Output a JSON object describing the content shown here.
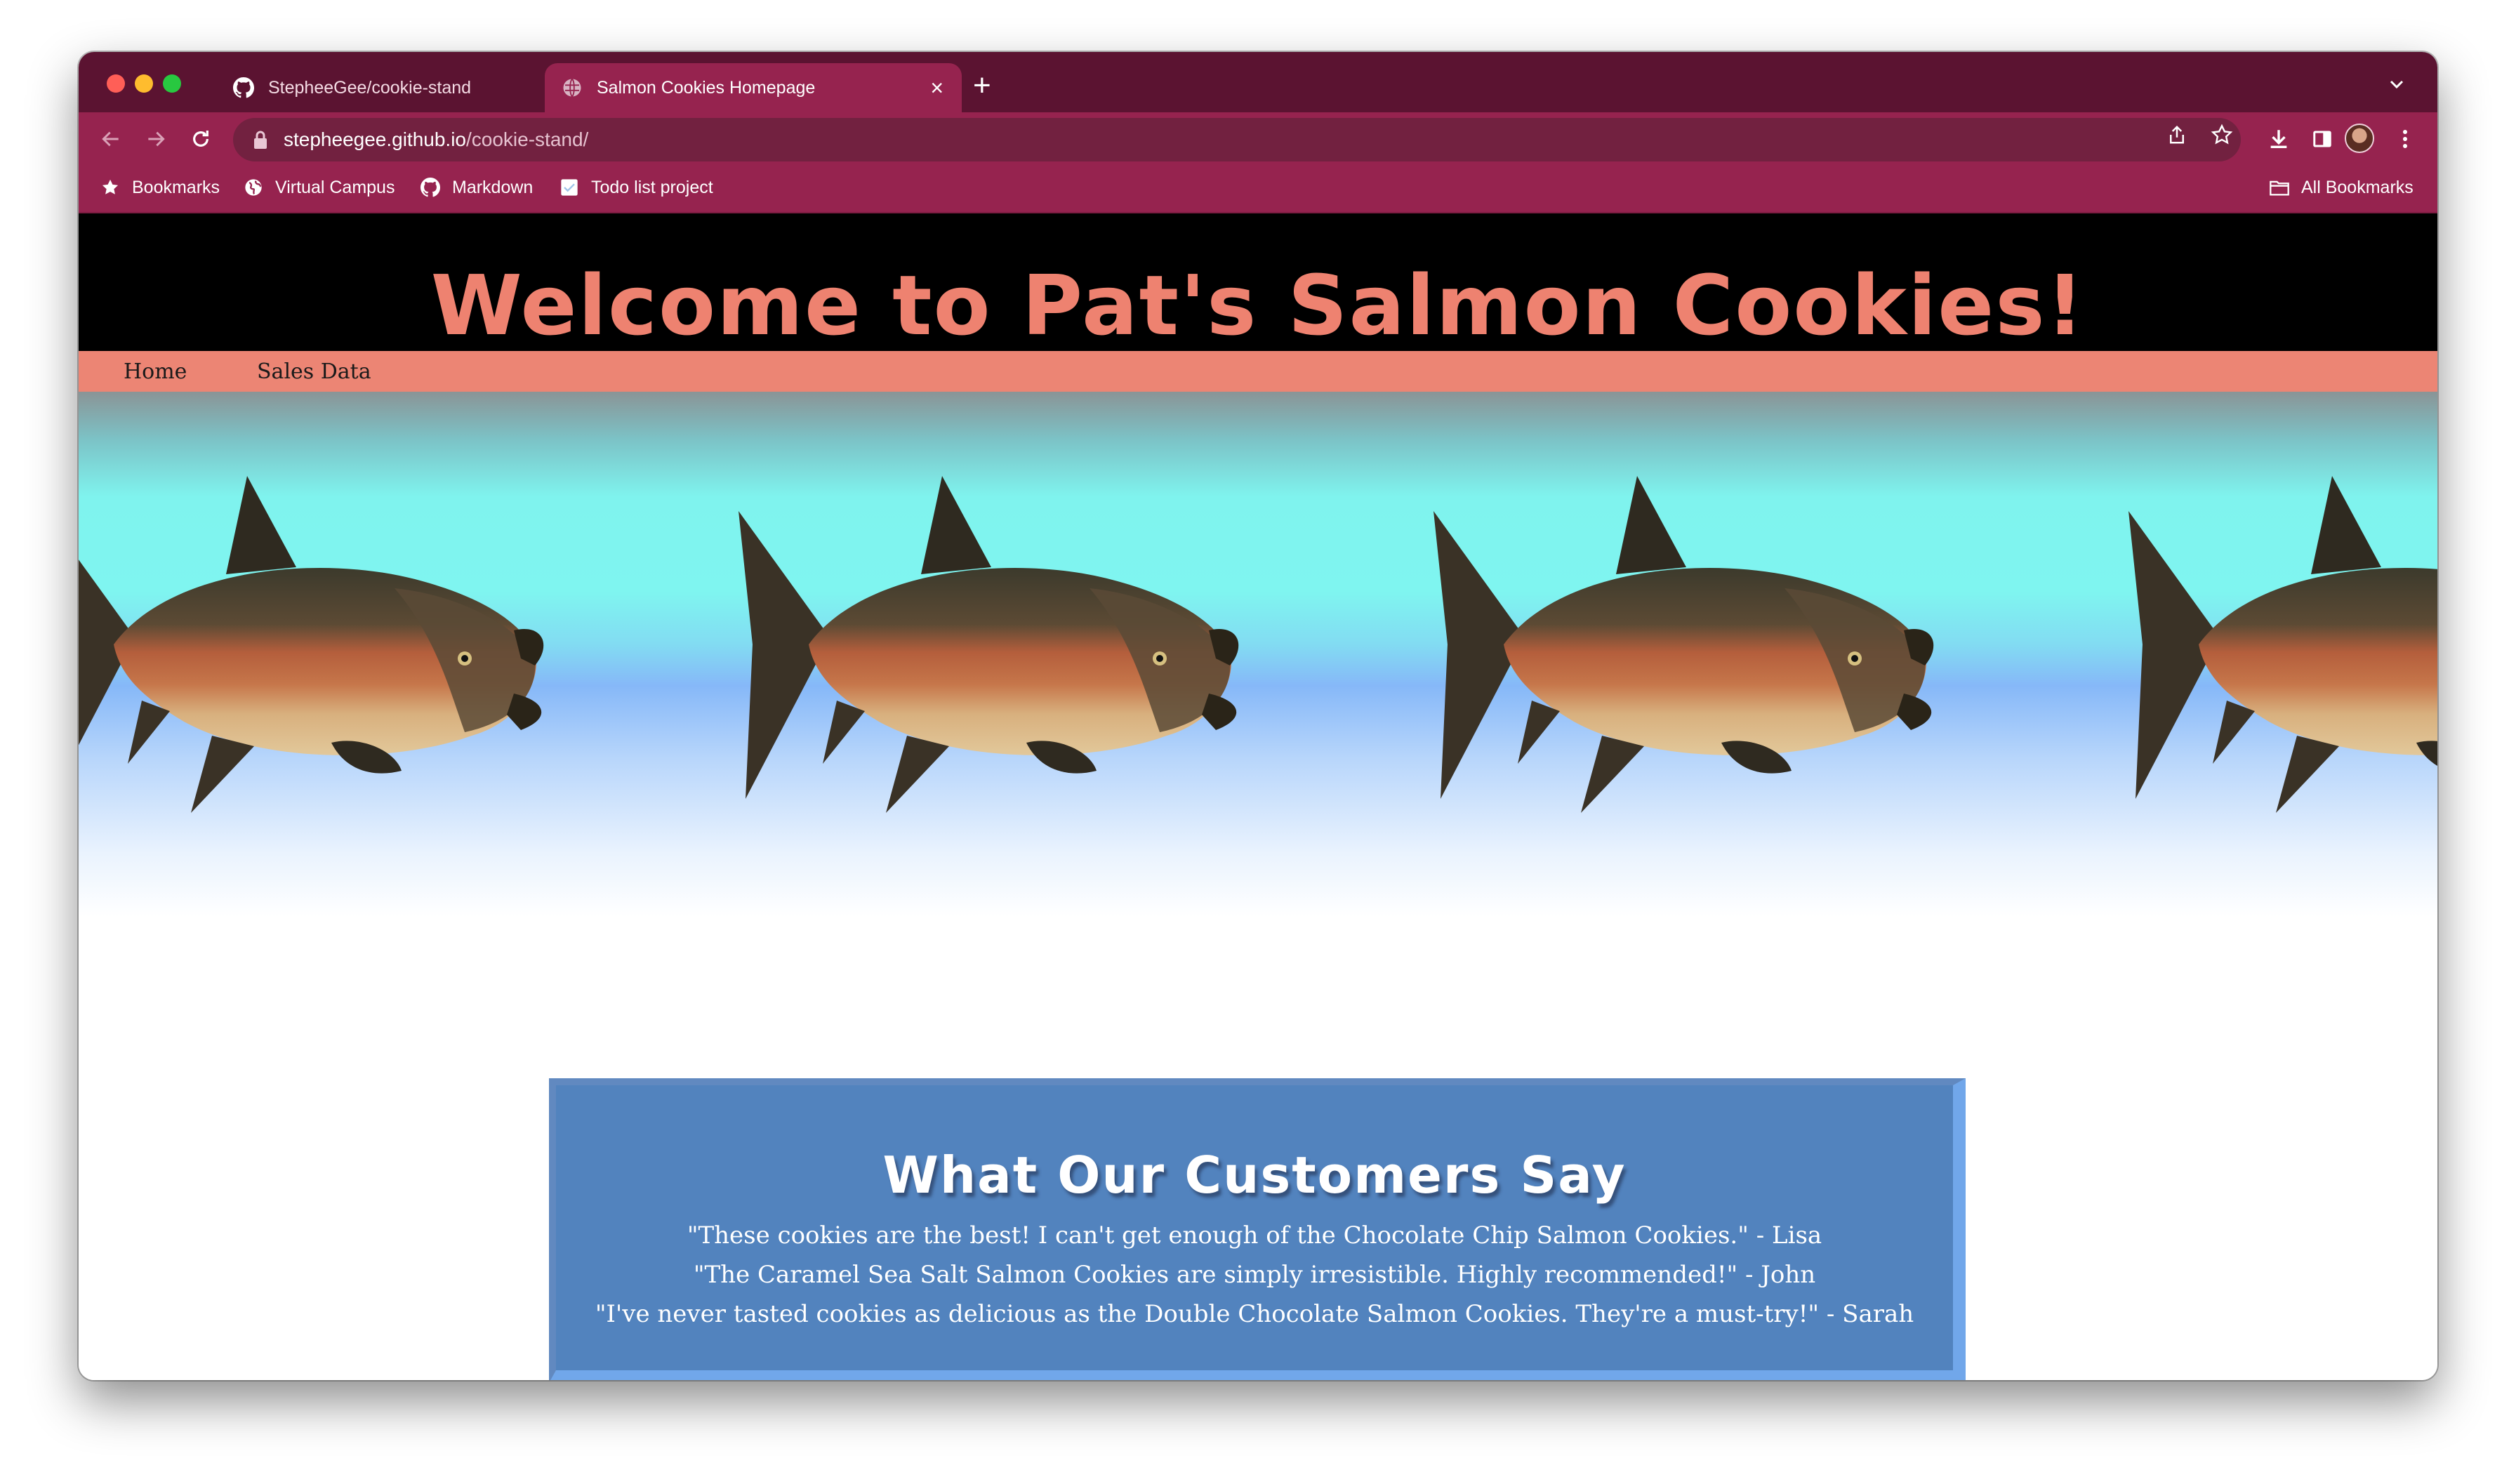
{
  "browser": {
    "tabs": [
      {
        "title": "StepheeGee/cookie-stand",
        "active": false,
        "icon": "github-icon"
      },
      {
        "title": "Salmon Cookies Homepage",
        "active": true,
        "icon": "globe-icon"
      }
    ],
    "url_host": "stepheegee.github.io",
    "url_path": "/cookie-stand/",
    "bookmarks": [
      {
        "label": "Bookmarks",
        "icon": "star-icon"
      },
      {
        "label": "Virtual Campus",
        "icon": "globe-icon"
      },
      {
        "label": "Markdown",
        "icon": "github-icon"
      },
      {
        "label": "Todo list project",
        "icon": "doc-icon"
      }
    ],
    "all_bookmarks": "All Bookmarks",
    "theme_color": "#96234f"
  },
  "page": {
    "title": "Welcome to Pat's Salmon Cookies!",
    "nav": [
      "Home",
      "Sales Data"
    ],
    "reviews_heading": "What Our Customers Say",
    "reviews": [
      "\"These cookies are the best! I can't get enough of the Chocolate Chip Salmon Cookies.\" - Lisa",
      "\"The Caramel Sea Salt Salmon Cookies are simply irresistible. Highly recommended!\" - John",
      "\"I've never tasted cookies as delicious as the Double Chocolate Salmon Cookies. They're a must-try!\" - Sarah"
    ],
    "colors": {
      "title": "#ee8270",
      "nav_bar": "#ec8574",
      "reviews_box": "#5283be"
    }
  }
}
